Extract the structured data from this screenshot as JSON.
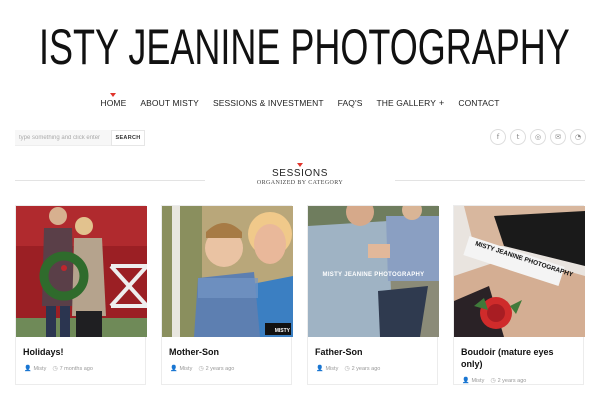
{
  "logo": {
    "text": "ISTY JEANINE PHOTOGRAPHY",
    "alt": "Misty Jeanine Photography"
  },
  "nav": {
    "items": [
      {
        "label": "HOME",
        "active": true
      },
      {
        "label": "ABOUT MISTY"
      },
      {
        "label": "SESSIONS & INVESTMENT"
      },
      {
        "label": "FAQ'S"
      },
      {
        "label": "THE GALLERY",
        "has_submenu": true
      },
      {
        "label": "CONTACT"
      }
    ],
    "submenu_icon": "+"
  },
  "search": {
    "placeholder": "type something and click enter",
    "button_label": "SEARCH"
  },
  "social": [
    {
      "icon": "facebook-icon",
      "glyph": "f"
    },
    {
      "icon": "twitter-icon",
      "glyph": "t"
    },
    {
      "icon": "instagram-icon",
      "glyph": "◎"
    },
    {
      "icon": "email-icon",
      "glyph": "✉"
    },
    {
      "icon": "rss-icon",
      "glyph": "◔"
    }
  ],
  "section": {
    "title": "SESSIONS",
    "subtitle": "ORGANIZED BY CATEGORY"
  },
  "cards": [
    {
      "title": "Holidays!",
      "author": "Misty",
      "date": "7 months ago"
    },
    {
      "title": "Mother-Son",
      "author": "Misty",
      "date": "2 years ago"
    },
    {
      "title": "Father-Son",
      "author": "Misty",
      "date": "2 years ago"
    },
    {
      "title": "Boudoir (mature eyes only)",
      "author": "Misty",
      "date": "2 years ago"
    }
  ],
  "watermark": {
    "card2": "MISTY",
    "card3": "MISTY JEANINE PHOTOGRAPHY",
    "card4": "MISTY JEANINE PHOTOGRAPHY"
  },
  "colors": {
    "accent": "#e0342b",
    "text": "#222222",
    "meta": "#999999"
  }
}
